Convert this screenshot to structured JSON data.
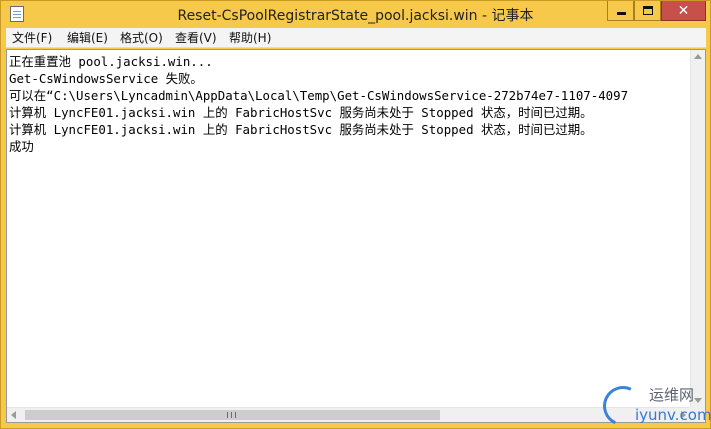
{
  "window": {
    "title": "Reset-CsPoolRegistrarState_pool.jacksi.win - 记事本",
    "close_glyph": "✕"
  },
  "menu": [
    {
      "label": "文件(F)"
    },
    {
      "label": "编辑(E)"
    },
    {
      "label": "格式(O)"
    },
    {
      "label": "查看(V)"
    },
    {
      "label": "帮助(H)"
    }
  ],
  "document": {
    "lines": [
      "正在重置池 pool.jacksi.win...",
      "Get-CsWindowsService 失败。",
      "可以在“C:\\Users\\Lyncadmin\\AppData\\Local\\Temp\\Get-CsWindowsService-272b74e7-1107-4097",
      "计算机 LyncFE01.jacksi.win 上的 FabricHostSvc 服务尚未处于 Stopped 状态，时间已过期。",
      "计算机 LyncFE01.jacksi.win 上的 FabricHostSvc 服务尚未处于 Stopped 状态，时间已过期。",
      "成功"
    ]
  },
  "watermark": {
    "cn": "运维网",
    "en": "iyunv.com"
  },
  "colors": {
    "titlebar": "#f6c94a",
    "close_button": "#c7504a",
    "editor_bg": "#ffffff"
  }
}
